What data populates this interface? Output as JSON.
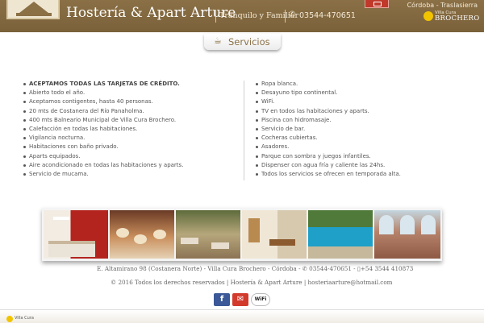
{
  "header": {
    "site_title": "Hostería & Apart Arture",
    "tagline": "Tranquilo y Familiar",
    "phone": "03544-470651",
    "region": "Córdoba - Traslasierra",
    "brand_small": "Villa Cura",
    "brand_big": "BROCHERO",
    "background_color": "#7a613a"
  },
  "section": {
    "title": "Servicios",
    "icon": "coffee-cup-icon"
  },
  "services_left": [
    "ACEPTAMOS TODAS LAS TARJETAS DE CRÉDITO.",
    "Abierto todo el año.",
    "Aceptamos contigentes, hasta 40 personas.",
    "20 mts de Costanera del Río Panaholma.",
    "400 mts Balneario Municipal de Villa Cura Brochero.",
    "Calefacción en todas las habitaciones.",
    "Vigilancia nocturna.",
    "Habitaciones con baño privado.",
    "Aparts equipados.",
    "Aire acondicionado en todas las habitaciones y aparts.",
    "Servicio de mucama."
  ],
  "services_right": [
    "Ropa blanca.",
    "Desayuno tipo continental.",
    "WiFi.",
    "TV en todos las habitaciones y aparts.",
    "Piscina con hidromasaje.",
    "Servicio de bar.",
    "Cocheras cubiertas.",
    "Asadores.",
    "Parque con sombra y juegos infantiles.",
    "Dispenser con agua fría y caliente las 24hs.",
    "Todos los servicios se ofrecen en temporada alta."
  ],
  "footer": {
    "address": "E. Altamirano 98 (Costanera Norte) - Villa Cura Brochero - Córdoba -",
    "phone": "03544-470651 -",
    "mobile": "+54 3544 410873",
    "copyright": "© 2016 Todos los derechos reservados | Hostería & Apart Arture | hosteriaarture@hotmail.com",
    "wifi_label": "WiFi",
    "mini_brand": "Villa Cura"
  }
}
